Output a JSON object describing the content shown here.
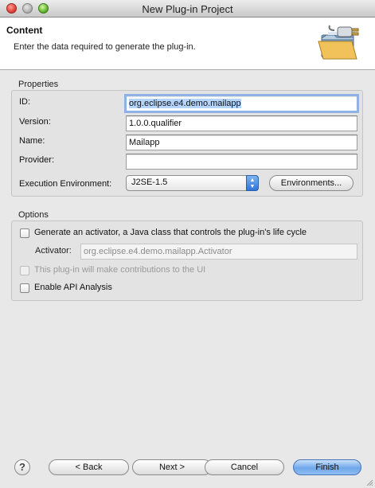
{
  "window": {
    "title": "New Plug-in Project"
  },
  "header": {
    "title": "Content",
    "description": "Enter the data required to generate the plug-in.",
    "icon": "plugin-folder-icon"
  },
  "properties": {
    "group_label": "Properties",
    "id_label": "ID:",
    "id_value": "org.eclipse.e4.demo.mailapp",
    "version_label": "Version:",
    "version_value": "1.0.0.qualifier",
    "name_label": "Name:",
    "name_value": "Mailapp",
    "provider_label": "Provider:",
    "provider_value": "",
    "exec_env_label": "Execution Environment:",
    "exec_env_value": "J2SE-1.5",
    "environments_button": "Environments..."
  },
  "options": {
    "group_label": "Options",
    "generate_activator_label": "Generate an activator, a Java class that controls the plug-in's life cycle",
    "generate_activator_checked": false,
    "activator_label": "Activator:",
    "activator_value": "org.eclipse.e4.demo.mailapp.Activator",
    "ui_contrib_label": "This plug-in will make contributions to the UI",
    "ui_contrib_checked": false,
    "api_analysis_label": "Enable API Analysis",
    "api_analysis_checked": false
  },
  "footer": {
    "help_label": "?",
    "back_label": "< Back",
    "next_label": "Next >",
    "cancel_label": "Cancel",
    "finish_label": "Finish"
  }
}
